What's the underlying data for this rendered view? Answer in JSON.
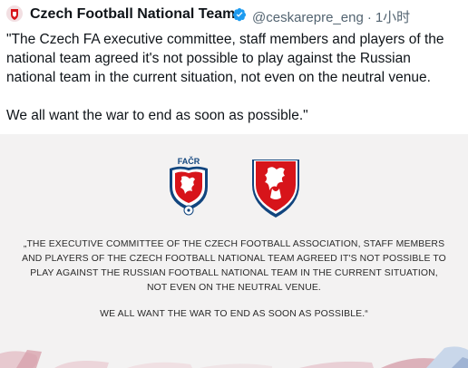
{
  "tweet": {
    "display_name": "Czech Football National Team",
    "handle": "@ceskarepre_eng",
    "separator": "·",
    "time": "1小时",
    "text_p1": "\"The Czech FA executive committee, staff members and players of the national team agreed it's not possible to play against the Russian national team in the current situation, not even on the neutral venue.",
    "text_p2": "We all want the war to end as soon as possible.\""
  },
  "media": {
    "facr_logo_text": "FAČR",
    "statement_lines": [
      "„THE EXECUTIVE COMMITTEE OF THE CZECH FOOTBALL ASSOCIATION, STAFF MEMBERS",
      "AND PLAYERS OF THE CZECH FOOTBALL NATIONAL TEAM AGREED IT'S NOT POSSIBLE TO",
      "PLAY AGAINST THE RUSSIAN FOOTBALL NATIONAL TEAM IN THE CURRENT SITUATION,",
      "NOT EVEN ON THE NEUTRAL VENUE."
    ],
    "statement_closing": "WE ALL WANT THE WAR TO END AS SOON AS POSSIBLE.“"
  },
  "colors": {
    "verified": "#1d9bf0",
    "crest_red": "#d7141a",
    "crest_blue": "#11457e"
  }
}
